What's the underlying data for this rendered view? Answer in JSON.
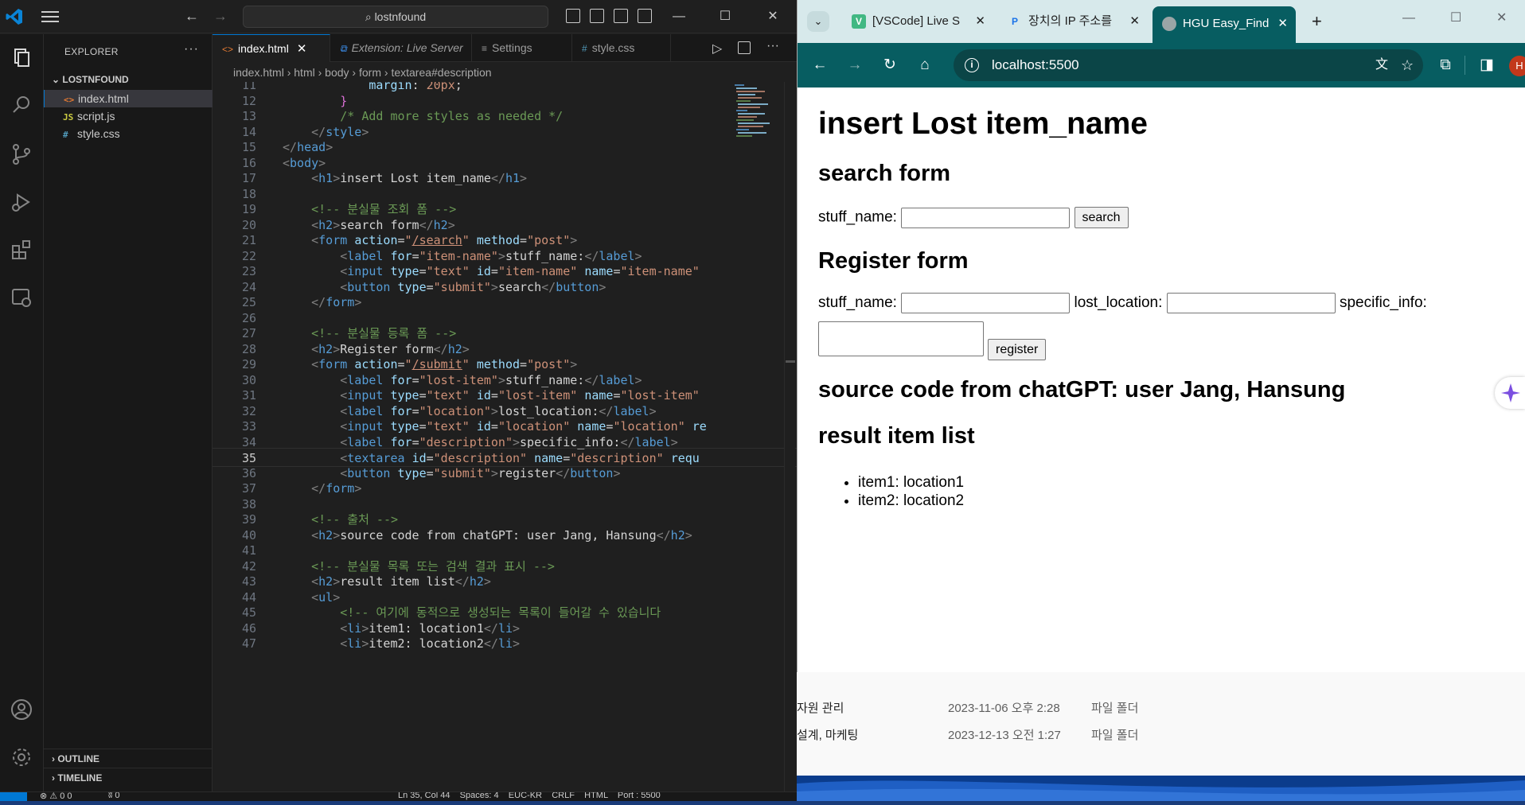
{
  "vscode": {
    "search_text": "lostnfound",
    "explorer_title": "EXPLORER",
    "folder_name": "LOSTNFOUND",
    "files": [
      {
        "icon": "<>",
        "name": "index.html",
        "active": true,
        "color": "#e37933"
      },
      {
        "icon": "JS",
        "name": "script.js",
        "active": false,
        "color": "#cbcb41"
      },
      {
        "icon": "#",
        "name": "style.css",
        "active": false,
        "color": "#519aba"
      }
    ],
    "outline_label": "OUTLINE",
    "timeline_label": "TIMELINE",
    "tabs": [
      {
        "label": "index.html",
        "active": true
      },
      {
        "label": "Extension: Live Server",
        "active": false
      },
      {
        "label": "Settings",
        "active": false
      },
      {
        "label": "style.css",
        "active": false
      }
    ],
    "breadcrumb": [
      "index.html",
      "html",
      "body",
      "form",
      "textarea#description"
    ],
    "status": "Ln 35, Col 44    Spaces: 4    EUC-KR    CRLF    HTML    Port : 5500",
    "status_problems": "0  0",
    "status_ports": "0"
  },
  "code_lines": [
    {
      "n": 11,
      "html": "<span class='t-prop'>            margin</span><span class='t-txt'>: </span><span class='t-str'>20px</span><span class='t-txt'>;</span>"
    },
    {
      "n": 12,
      "html": "<span class='t-brace'>        }</span>"
    },
    {
      "n": 13,
      "html": "<span class='t-cmt'>        /* Add more styles as needed */</span>"
    },
    {
      "n": 14,
      "html": "<span class='t-br'>    &lt;/</span><span class='t-tag'>style</span><span class='t-br'>&gt;</span>"
    },
    {
      "n": 15,
      "html": "<span class='t-br'>&lt;/</span><span class='t-tag'>head</span><span class='t-br'>&gt;</span>"
    },
    {
      "n": 16,
      "html": "<span class='t-br'>&lt;</span><span class='t-tag'>body</span><span class='t-br'>&gt;</span>"
    },
    {
      "n": 17,
      "html": "<span class='t-br'>    &lt;</span><span class='t-tag'>h1</span><span class='t-br'>&gt;</span><span class='t-txt'>insert Lost item_name</span><span class='t-br'>&lt;/</span><span class='t-tag'>h1</span><span class='t-br'>&gt;</span>"
    },
    {
      "n": 18,
      "html": ""
    },
    {
      "n": 19,
      "html": "<span class='t-cmt'>    &lt;!-- 분실물 조회 폼 --&gt;</span>"
    },
    {
      "n": 20,
      "html": "<span class='t-br'>    &lt;</span><span class='t-tag'>h2</span><span class='t-br'>&gt;</span><span class='t-txt'>search form</span><span class='t-br'>&lt;/</span><span class='t-tag'>h2</span><span class='t-br'>&gt;</span>"
    },
    {
      "n": 21,
      "html": "<span class='t-br'>    &lt;</span><span class='t-tag'>form</span> <span class='t-attr'>action</span><span class='t-txt'>=</span><span class='t-str'>\"<u>/search</u>\"</span> <span class='t-attr'>method</span><span class='t-txt'>=</span><span class='t-str'>\"post\"</span><span class='t-br'>&gt;</span>"
    },
    {
      "n": 22,
      "html": "<span class='t-br'>        &lt;</span><span class='t-tag'>label</span> <span class='t-attr'>for</span><span class='t-txt'>=</span><span class='t-str'>\"item-name\"</span><span class='t-br'>&gt;</span><span class='t-txt'>stuff_name:</span><span class='t-br'>&lt;/</span><span class='t-tag'>label</span><span class='t-br'>&gt;</span>"
    },
    {
      "n": 23,
      "html": "<span class='t-br'>        &lt;</span><span class='t-tag'>input</span> <span class='t-attr'>type</span><span class='t-txt'>=</span><span class='t-str'>\"text\"</span> <span class='t-attr'>id</span><span class='t-txt'>=</span><span class='t-str'>\"item-name\"</span> <span class='t-attr'>name</span><span class='t-txt'>=</span><span class='t-str'>\"item-name\"</span>"
    },
    {
      "n": 24,
      "html": "<span class='t-br'>        &lt;</span><span class='t-tag'>button</span> <span class='t-attr'>type</span><span class='t-txt'>=</span><span class='t-str'>\"submit\"</span><span class='t-br'>&gt;</span><span class='t-txt'>search</span><span class='t-br'>&lt;/</span><span class='t-tag'>button</span><span class='t-br'>&gt;</span>"
    },
    {
      "n": 25,
      "html": "<span class='t-br'>    &lt;/</span><span class='t-tag'>form</span><span class='t-br'>&gt;</span>"
    },
    {
      "n": 26,
      "html": ""
    },
    {
      "n": 27,
      "html": "<span class='t-cmt'>    &lt;!-- 분실물 등록 폼 --&gt;</span>"
    },
    {
      "n": 28,
      "html": "<span class='t-br'>    &lt;</span><span class='t-tag'>h2</span><span class='t-br'>&gt;</span><span class='t-txt'>Register form</span><span class='t-br'>&lt;/</span><span class='t-tag'>h2</span><span class='t-br'>&gt;</span>"
    },
    {
      "n": 29,
      "html": "<span class='t-br'>    &lt;</span><span class='t-tag'>form</span> <span class='t-attr'>action</span><span class='t-txt'>=</span><span class='t-str'>\"<u>/submit</u>\"</span> <span class='t-attr'>method</span><span class='t-txt'>=</span><span class='t-str'>\"post\"</span><span class='t-br'>&gt;</span>"
    },
    {
      "n": 30,
      "html": "<span class='t-br'>        &lt;</span><span class='t-tag'>label</span> <span class='t-attr'>for</span><span class='t-txt'>=</span><span class='t-str'>\"lost-item\"</span><span class='t-br'>&gt;</span><span class='t-txt'>stuff_name:</span><span class='t-br'>&lt;/</span><span class='t-tag'>label</span><span class='t-br'>&gt;</span>"
    },
    {
      "n": 31,
      "html": "<span class='t-br'>        &lt;</span><span class='t-tag'>input</span> <span class='t-attr'>type</span><span class='t-txt'>=</span><span class='t-str'>\"text\"</span> <span class='t-attr'>id</span><span class='t-txt'>=</span><span class='t-str'>\"lost-item\"</span> <span class='t-attr'>name</span><span class='t-txt'>=</span><span class='t-str'>\"lost-item\"</span>"
    },
    {
      "n": 32,
      "html": "<span class='t-br'>        &lt;</span><span class='t-tag'>label</span> <span class='t-attr'>for</span><span class='t-txt'>=</span><span class='t-str'>\"location\"</span><span class='t-br'>&gt;</span><span class='t-txt'>lost_location:</span><span class='t-br'>&lt;/</span><span class='t-tag'>label</span><span class='t-br'>&gt;</span>"
    },
    {
      "n": 33,
      "html": "<span class='t-br'>        &lt;</span><span class='t-tag'>input</span> <span class='t-attr'>type</span><span class='t-txt'>=</span><span class='t-str'>\"text\"</span> <span class='t-attr'>id</span><span class='t-txt'>=</span><span class='t-str'>\"location\"</span> <span class='t-attr'>name</span><span class='t-txt'>=</span><span class='t-str'>\"location\"</span> <span class='t-attr'>re</span>"
    },
    {
      "n": 34,
      "html": "<span class='t-br'>        &lt;</span><span class='t-tag'>label</span> <span class='t-attr'>for</span><span class='t-txt'>=</span><span class='t-str'>\"description\"</span><span class='t-br'>&gt;</span><span class='t-txt'>specific_info:</span><span class='t-br'>&lt;/</span><span class='t-tag'>label</span><span class='t-br'>&gt;</span>"
    },
    {
      "n": 35,
      "cur": true,
      "html": "<span class='t-br'>        &lt;</span><span class='t-tag'>textarea</span> <span class='t-attr'>id</span><span class='t-txt'>=</span><span class='t-str'>\"description\"</span> <span class='t-attr'>name</span><span class='t-txt'>=</span><span class='t-str'>\"description\"</span> <span class='t-attr'>requ</span>"
    },
    {
      "n": 36,
      "html": "<span class='t-br'>        &lt;</span><span class='t-tag'>button</span> <span class='t-attr'>type</span><span class='t-txt'>=</span><span class='t-str'>\"submit\"</span><span class='t-br'>&gt;</span><span class='t-txt'>register</span><span class='t-br'>&lt;/</span><span class='t-tag'>button</span><span class='t-br'>&gt;</span>"
    },
    {
      "n": 37,
      "html": "<span class='t-br'>    &lt;/</span><span class='t-tag'>form</span><span class='t-br'>&gt;</span>"
    },
    {
      "n": 38,
      "html": ""
    },
    {
      "n": 39,
      "html": "<span class='t-cmt'>    &lt;!-- 출처 --&gt;</span>"
    },
    {
      "n": 40,
      "html": "<span class='t-br'>    &lt;</span><span class='t-tag'>h2</span><span class='t-br'>&gt;</span><span class='t-txt'>source code from chatGPT: user Jang, Hansung</span><span class='t-br'>&lt;/</span><span class='t-tag'>h2</span><span class='t-br'>&gt;</span>"
    },
    {
      "n": 41,
      "html": ""
    },
    {
      "n": 42,
      "html": "<span class='t-cmt'>    &lt;!-- 분실물 목록 또는 검색 결과 표시 --&gt;</span>"
    },
    {
      "n": 43,
      "html": "<span class='t-br'>    &lt;</span><span class='t-tag'>h2</span><span class='t-br'>&gt;</span><span class='t-txt'>result item list</span><span class='t-br'>&lt;/</span><span class='t-tag'>h2</span><span class='t-br'>&gt;</span>"
    },
    {
      "n": 44,
      "html": "<span class='t-br'>    &lt;</span><span class='t-tag'>ul</span><span class='t-br'>&gt;</span>"
    },
    {
      "n": 45,
      "html": "<span class='t-cmt'>        &lt;!-- 여기에 동적으로 생성되는 목록이 들어갈 수 있습니다</span>"
    },
    {
      "n": 46,
      "html": "<span class='t-br'>        &lt;</span><span class='t-tag'>li</span><span class='t-br'>&gt;</span><span class='t-txt'>item1: location1</span><span class='t-br'>&lt;/</span><span class='t-tag'>li</span><span class='t-br'>&gt;</span>"
    },
    {
      "n": 47,
      "html": "<span class='t-br'>        &lt;</span><span class='t-tag'>li</span><span class='t-br'>&gt;</span><span class='t-txt'>item2: location2</span><span class='t-br'>&lt;/</span><span class='t-tag'>li</span><span class='t-br'>&gt;</span>"
    }
  ],
  "chrome": {
    "tabs": [
      {
        "label": "[VSCode] Live S",
        "fav": "V",
        "fav_bg": "#41b883",
        "active": false
      },
      {
        "label": "장치의 IP 주소를",
        "fav": "P",
        "fav_bg": "#ffffff",
        "active": false
      },
      {
        "label": "HGU Easy_Find",
        "fav": "",
        "fav_bg": "#9aa5a6",
        "active": true
      }
    ],
    "url": "localhost:5500",
    "avatar_letter": "H"
  },
  "page": {
    "h1": "insert Lost item_name",
    "search_heading": "search form",
    "search_label": "stuff_name:",
    "search_button": "search",
    "register_heading": "Register form",
    "reg_name_label": "stuff_name:",
    "reg_location_label": "lost_location:",
    "reg_info_label": "specific_info:",
    "register_button": "register",
    "source_heading": "source code from chatGPT: user Jang, Hansung",
    "result_heading": "result item list",
    "items": [
      "item1: location1",
      "item2: location2"
    ]
  },
  "explorer_bg": {
    "rows": [
      {
        "name": "자원 관리",
        "date": "2023-11-06 오후 2:28",
        "type": "파일 폴더"
      },
      {
        "name": "설계, 마케팅",
        "date": "2023-12-13 오전 1:27",
        "type": "파일 폴더"
      }
    ]
  }
}
